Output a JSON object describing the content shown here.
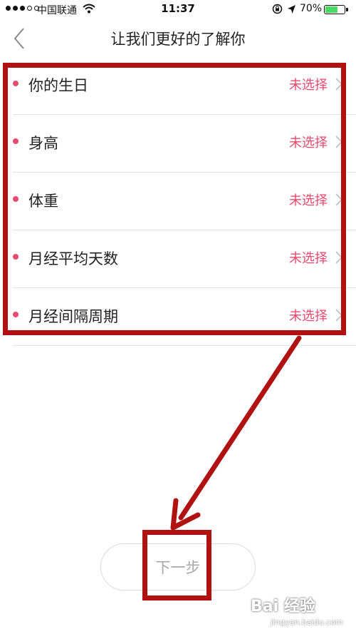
{
  "status_bar": {
    "carrier": "中国联通",
    "time": "11:37",
    "battery": "70%",
    "battery_level": 0.7
  },
  "header": {
    "title": "让我们更好的了解你"
  },
  "items": [
    {
      "label": "你的生日",
      "value": "未选择"
    },
    {
      "label": "身高",
      "value": "未选择"
    },
    {
      "label": "体重",
      "value": "未选择"
    },
    {
      "label": "月经平均天数",
      "value": "未选择"
    },
    {
      "label": "月经间隔周期",
      "value": "未选择"
    }
  ],
  "next_button": {
    "label": "下一步"
  },
  "watermark": {
    "logo": "Bai 经验",
    "domain": "jingyan.baidu.com"
  },
  "colors": {
    "accent": "#e84a6f",
    "annotation": "#b01212",
    "battery": "#4cd964"
  }
}
